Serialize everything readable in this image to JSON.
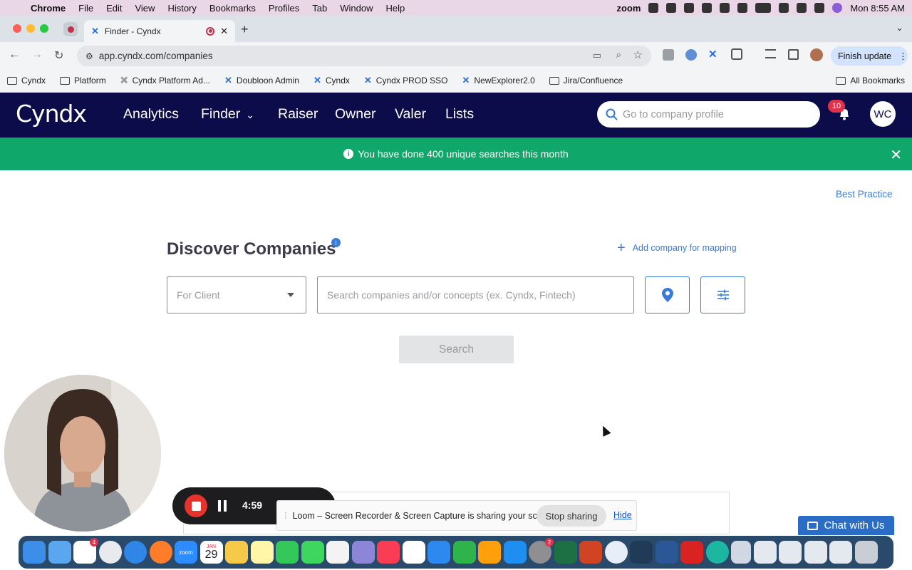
{
  "menubar": {
    "app": "Chrome",
    "items": [
      "File",
      "Edit",
      "View",
      "History",
      "Bookmarks",
      "Profiles",
      "Tab",
      "Window",
      "Help"
    ],
    "zoom_label": "zoom",
    "clock": "Mon  8:55 AM"
  },
  "browser": {
    "tab_title": "Finder - Cyndx",
    "url": "app.cyndx.com/companies",
    "finish_update": "Finish update",
    "bookmarks": [
      {
        "label": "Cyndx",
        "icon": "folder-icon"
      },
      {
        "label": "Platform",
        "icon": "folder-icon"
      },
      {
        "label": "Cyndx Platform Ad...",
        "icon": "cyndx-icon"
      },
      {
        "label": "Doubloon Admin",
        "icon": "cyndx-icon"
      },
      {
        "label": "Cyndx",
        "icon": "cyndx-icon"
      },
      {
        "label": "Cyndx PROD SSO",
        "icon": "cyndx-icon"
      },
      {
        "label": "NewExplorer2.0",
        "icon": "cyndx-icon"
      },
      {
        "label": "Jira/Confluence",
        "icon": "folder-icon"
      }
    ],
    "all_bookmarks": "All Bookmarks"
  },
  "app": {
    "logo": "Cyndx",
    "nav": [
      "Analytics",
      "Finder",
      "Raiser",
      "Owner",
      "Valer",
      "Lists"
    ],
    "search_placeholder": "Go to company profile",
    "notifications": "10",
    "avatar": "WC",
    "banner": "You have done 400 unique searches this month",
    "best_practice": "Best Practice",
    "title": "Discover Companies",
    "add_company": "Add company for mapping",
    "client_placeholder": "For Client",
    "search_companies_placeholder": "Search companies and/or concepts (ex. Cyndx, Fintech)",
    "search_button": "Search",
    "chat": "Chat with Us",
    "colors": {
      "nav_bg": "#0c0c4a",
      "banner": "#10a86a",
      "accent": "#3a7bd5"
    }
  },
  "loom": {
    "timer": "4:59",
    "sharing_text": "Loom – Screen Recorder & Screen Capture is sharing your screen.",
    "stop_sharing": "Stop sharing",
    "hide": "Hide"
  },
  "dock": {
    "calendar_month": "JAN",
    "calendar_day": "29",
    "zoom_label": "zoom"
  }
}
